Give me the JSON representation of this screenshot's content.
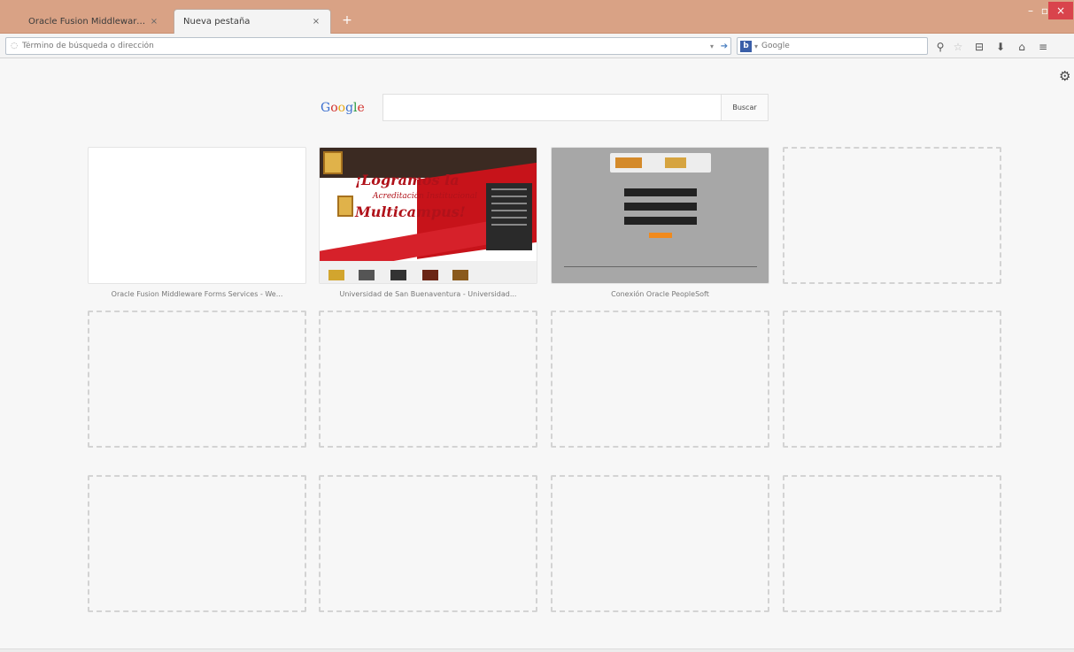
{
  "tabs": [
    {
      "title": "Oracle Fusion Middleware For...",
      "close": "×"
    },
    {
      "title": "Nueva pestaña",
      "close": "×"
    }
  ],
  "new_tab_symbol": "+",
  "window_controls": {
    "minimize": "–",
    "maximize": "▫",
    "close": "×"
  },
  "url_bar": {
    "placeholder": "Término de búsqueda o dirección",
    "dropdown": "▾",
    "reload": "➔"
  },
  "search_bar": {
    "engine_letter": "b",
    "placeholder": "Google"
  },
  "toolbar_icons": [
    "search-icon",
    "star-icon",
    "bookmarks-icon",
    "download-icon",
    "home-icon",
    "menu-icon"
  ],
  "toolbar_glyphs": {
    "search": "⚲",
    "star": "☆",
    "bookmarks": "⊟",
    "downloads": "⬇",
    "home": "⌂",
    "menu": "≡"
  },
  "customize_glyph": "⚙",
  "google": {
    "logo_letters": [
      {
        "ch": "G",
        "color": "#3b6fcf"
      },
      {
        "ch": "o",
        "color": "#d2322d"
      },
      {
        "ch": "o",
        "color": "#e6a815"
      },
      {
        "ch": "g",
        "color": "#3b6fcf"
      },
      {
        "ch": "l",
        "color": "#2a9a3f"
      },
      {
        "ch": "e",
        "color": "#d2322d"
      }
    ],
    "button": "Buscar"
  },
  "tiles": [
    {
      "caption": "Oracle Fusion Middleware Forms Services - We...",
      "filled": true,
      "thumb": "blank"
    },
    {
      "caption": "Universidad de San Buenaventura - Universidad...",
      "filled": true,
      "thumb": "university"
    },
    {
      "caption": "Conexión Oracle PeopleSoft",
      "filled": true,
      "thumb": "peoplesoft"
    },
    {
      "caption": "",
      "filled": false
    },
    {
      "caption": "",
      "filled": false
    },
    {
      "caption": "",
      "filled": false
    },
    {
      "caption": "",
      "filled": false
    },
    {
      "caption": "",
      "filled": false
    },
    {
      "caption": "",
      "filled": false
    },
    {
      "caption": "",
      "filled": false
    },
    {
      "caption": "",
      "filled": false
    },
    {
      "caption": "",
      "filled": false
    }
  ],
  "university_thumb": {
    "headline": "¡Logramos la",
    "subline": "Acreditación Institucional",
    "headline2": "Multicampus!"
  },
  "colors": {
    "titlebar": "#d9a285",
    "close_button": "#d9444c",
    "accent_red": "#c7131a",
    "peoplesoft_orange": "#f08a1d"
  }
}
